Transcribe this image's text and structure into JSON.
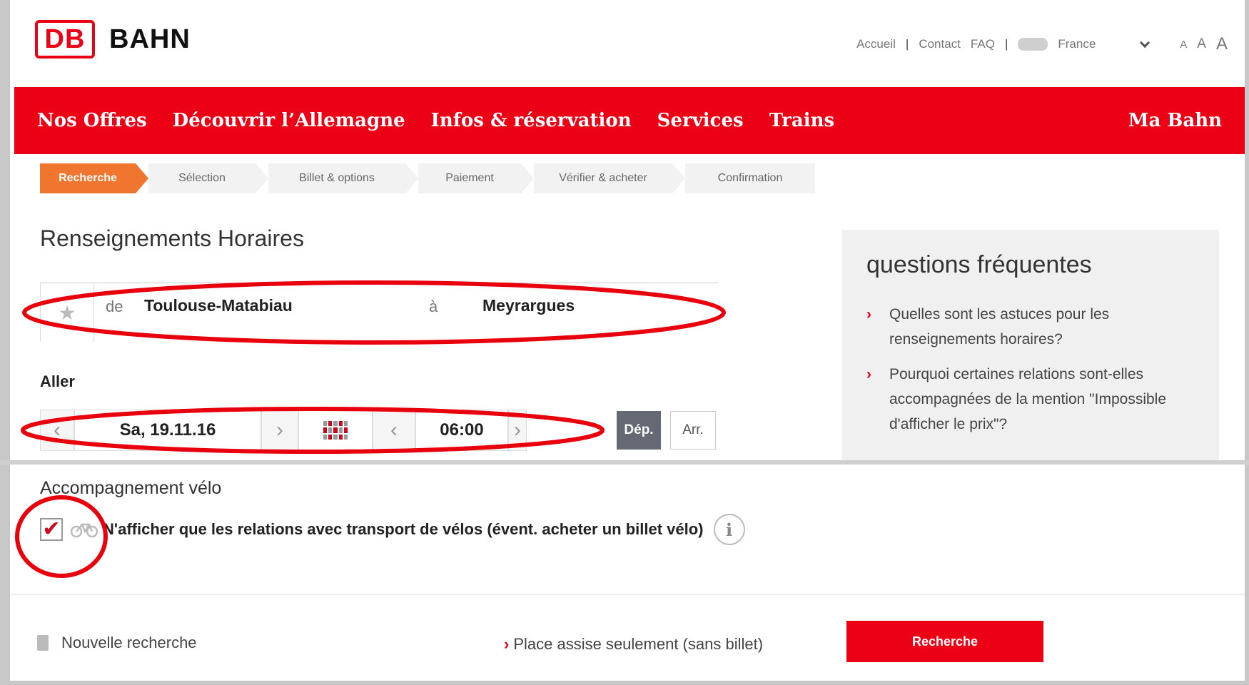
{
  "header": {
    "logo_mark": "DB",
    "logo_text": "BAHN",
    "meta_nav": [
      "Accueil",
      "Contact",
      "FAQ",
      "France"
    ],
    "font_size_labels": [
      "A",
      "A",
      "A"
    ]
  },
  "main_nav": {
    "items": [
      "Nos Offres",
      "Découvrir l’Allemagne",
      "Infos & réservation",
      "Services",
      "Trains"
    ],
    "account": "Ma Bahn"
  },
  "steps": [
    "Recherche",
    "Sélection",
    "Billet & options",
    "Paiement",
    "Vérifier & acheter",
    "Confirmation"
  ],
  "search": {
    "title": "Renseignements Horaires",
    "from_label": "de",
    "from_value": "Toulouse-Matabiau",
    "to_label": "à",
    "to_value": "Meyrargues",
    "outbound_label": "Aller",
    "date": "Sa, 19.11.16",
    "time": "06:00",
    "departure_button": "Dép.",
    "arrival_button": "Arr."
  },
  "faq": {
    "title": "questions fréquentes",
    "items": [
      "Quelles sont les astuces pour les renseignements horaires?",
      "Pourquoi certaines relations sont-elles accompagnées de la mention \"Impossible d'afficher le prix\"?"
    ]
  },
  "bike": {
    "title": "Accompagnement vélo",
    "checkbox_label": "N'afficher que les relations avec transport de vélos (évent. acheter un billet vélo)",
    "checked": true,
    "info_glyph": "i"
  },
  "footer": {
    "new_search": "Nouvelle recherche",
    "seat_only": "Place assise seulement (sans billet)",
    "search_button": "Recherche"
  },
  "colors": {
    "brand_red": "#ec0016",
    "active_step": "#f0752e",
    "annotation": "#e8000d"
  }
}
